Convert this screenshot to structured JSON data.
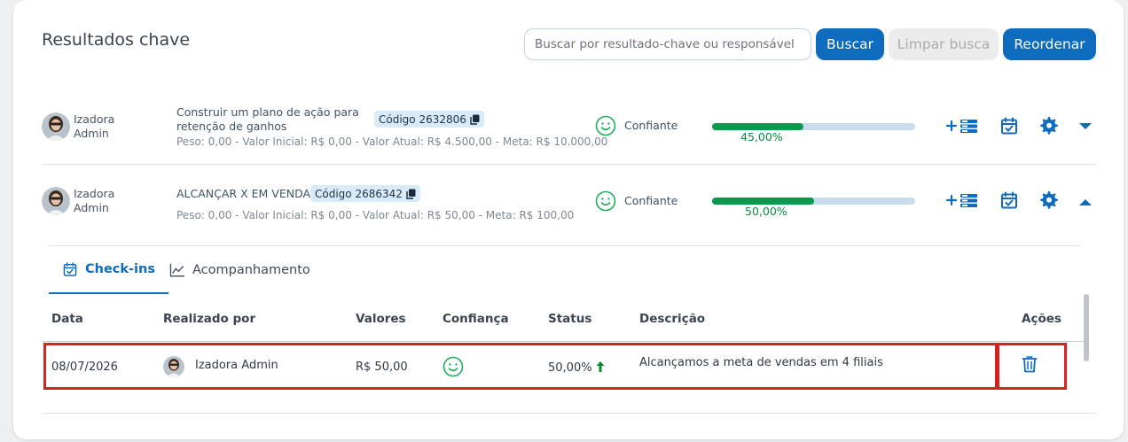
{
  "page": {
    "title": "Resultados chave"
  },
  "toolbar": {
    "search_placeholder": "Buscar por resultado-chave ou responsável",
    "search_label": "Buscar",
    "clear_label": "Limpar busca",
    "reorder_label": "Reordenar"
  },
  "colors": {
    "primary": "#0f6bbd",
    "progress": "#0a9a4e",
    "progress_track": "#c9dced",
    "confidence": "#1fae5b",
    "highlight": "#d9221e",
    "status_up": "#0a8a2e"
  },
  "key_results": [
    {
      "owner_first": "Izadora",
      "owner_last": "Admin",
      "title": "Construir um plano de ação para retenção de ganhos",
      "code": "Código 2632806",
      "meta": "Peso: 0,00 -  Valor Inicial: R$ 0,00  -   Valor Atual: R$ 4.500,00  -   Meta: R$ 10.000,00",
      "confidence": "Confiante",
      "progress_text": "45,00%",
      "progress": 0.45,
      "expanded": false
    },
    {
      "owner_first": "Izadora",
      "owner_last": "Admin",
      "title": "ALCANÇAR X EM VENDAS",
      "code": "Código 2686342",
      "meta": "Peso: 0,00 -  Valor Inicial: R$ 0,00  -   Valor Atual: R$ 50,00  -   Meta: R$ 100,00",
      "confidence": "Confiante",
      "progress_text": "50,00%",
      "progress": 0.5,
      "expanded": true
    }
  ],
  "tabs": [
    {
      "label": "Check-ins",
      "icon": "calendar-check-icon",
      "active": true
    },
    {
      "label": "Acompanhamento",
      "icon": "line-chart-icon",
      "active": false
    }
  ],
  "checkins": {
    "columns": [
      "Data",
      "Realizado por",
      "Valores",
      "Confiança",
      "Status",
      "Descrição",
      "Ações"
    ],
    "rows": [
      {
        "date": "08/07/2026",
        "by": "Izadora Admin",
        "value": "R$ 50,00",
        "confidence": "smile-icon",
        "status": "50,00%",
        "status_icon": "arrow-up-icon",
        "description": "Alcançamos a meta de vendas em 4 filiais",
        "action": "trash-icon"
      }
    ]
  }
}
